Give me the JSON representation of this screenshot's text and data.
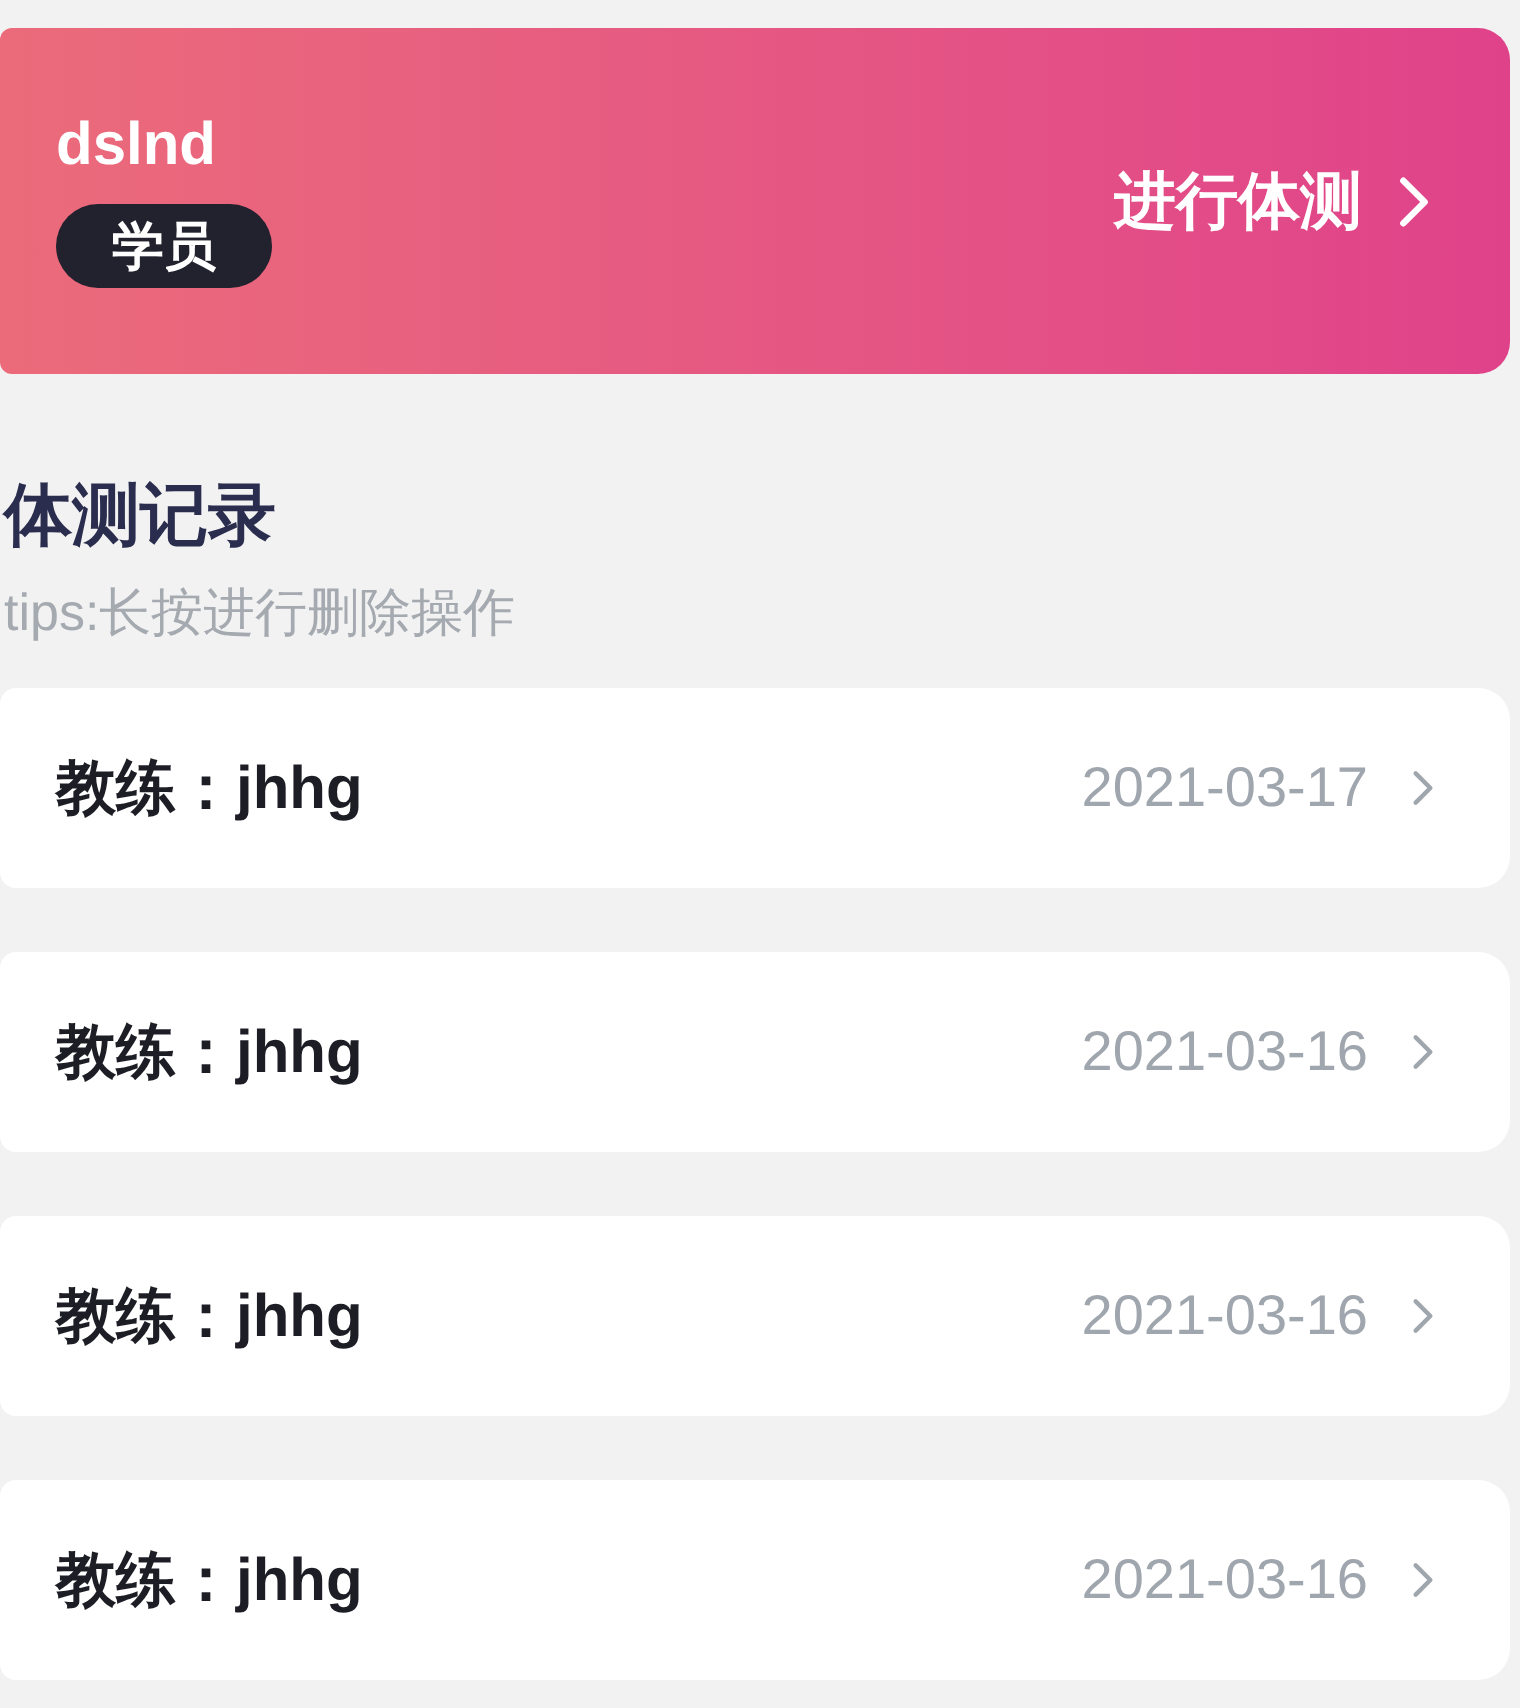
{
  "profile": {
    "name": "dslnd",
    "role": "学员",
    "action": "进行体测"
  },
  "section": {
    "title": "体测记录",
    "tips": "tips:长按进行删除操作"
  },
  "records": [
    {
      "coach": "教练：jhhg",
      "date": "2021-03-17"
    },
    {
      "coach": "教练：jhhg",
      "date": "2021-03-16"
    },
    {
      "coach": "教练：jhhg",
      "date": "2021-03-16"
    },
    {
      "coach": "教练：jhhg",
      "date": "2021-03-16"
    }
  ]
}
